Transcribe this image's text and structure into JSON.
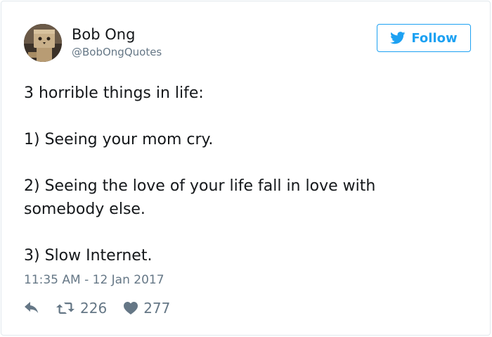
{
  "author": {
    "name": "Bob Ong",
    "handle": "@BobOngQuotes",
    "avatar_icon": "danbo-figure-avatar"
  },
  "follow_button": {
    "label": "Follow",
    "icon": "twitter-bird-icon",
    "color": "#1da1f2"
  },
  "tweet": {
    "lines": [
      "3 horrible things in life:",
      "",
      "1) Seeing your mom cry.",
      "",
      "2) Seeing the love of your life fall in love with",
      "somebody else.",
      "",
      "3) Slow Internet."
    ],
    "timestamp": "11:35 AM - 12 Jan 2017"
  },
  "actions": {
    "reply_icon": "reply-icon",
    "retweet_icon": "retweet-icon",
    "retweet_count": "226",
    "like_icon": "heart-icon",
    "like_count": "277"
  }
}
